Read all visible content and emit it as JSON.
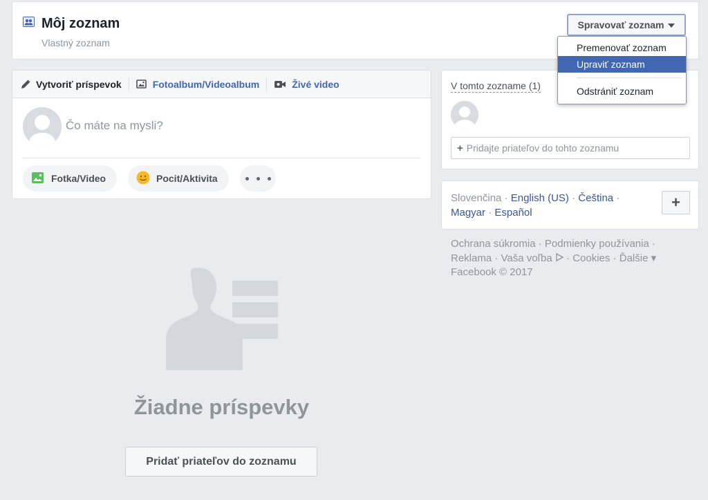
{
  "header": {
    "title": "Môj zoznam",
    "subtitle": "Vlastný zoznam",
    "manage_button": "Spravovať zoznam",
    "icon": "friend-list-icon"
  },
  "dropdown": {
    "items": [
      {
        "label": "Premenovať zoznam",
        "active": false
      },
      {
        "label": "Upraviť zoznam",
        "active": true
      },
      {
        "label": "Odstrániť zoznam",
        "active": false
      }
    ]
  },
  "composer": {
    "tabs": [
      {
        "label": "Vytvoriť príspevok",
        "icon": "pencil-icon"
      },
      {
        "label": "Fotoalbum/Videoalbum",
        "icon": "photo-album-icon"
      },
      {
        "label": "Živé video",
        "icon": "video-camera-icon"
      }
    ],
    "placeholder": "Čo máte na mysli?",
    "actions": {
      "photo": "Fotka/Video",
      "feeling": "Pocit/Aktivita",
      "more": "more-icon"
    }
  },
  "members": {
    "title": "V tomto zozname (1)",
    "add_placeholder": "Pridajte priateľov do tohto zoznamu"
  },
  "languages": {
    "current": "Slovenčina",
    "links": [
      "English (US)",
      "Čeština",
      "Magyar",
      "Español"
    ],
    "separator": "·",
    "add_label": "+"
  },
  "footer": {
    "links": [
      "Ochrana súkromia",
      "Podmienky používania",
      "Reklama",
      "Vaša voľba",
      "Cookies",
      "Ďalšie"
    ],
    "more_caret": "▾",
    "copyright": "Facebook © 2017"
  },
  "empty_state": {
    "title": "Žiadne príspevky",
    "button": "Pridať priateľov do zoznamu"
  },
  "colors": {
    "accent": "#4267b2",
    "link": "#365899",
    "background": "#e9ebee",
    "muted": "#90949c"
  }
}
